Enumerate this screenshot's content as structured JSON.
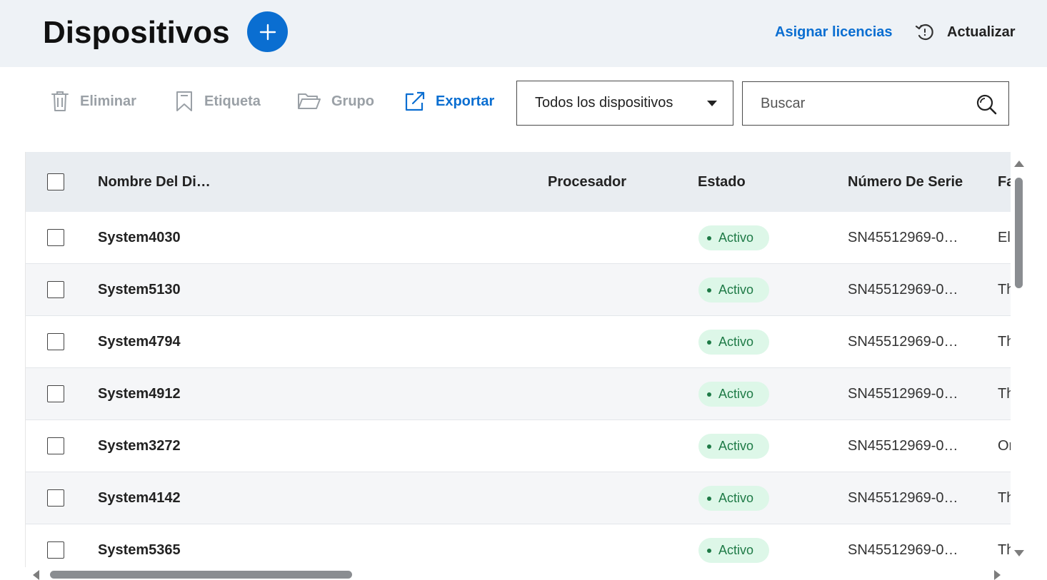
{
  "header": {
    "title": "Dispositivos",
    "assign_licenses": "Asignar licencias",
    "refresh": "Actualizar"
  },
  "toolbar": {
    "delete": "Eliminar",
    "tag": "Etiqueta",
    "group": "Grupo",
    "export": "Exportar",
    "filter_value": "Todos los dispositivos",
    "search_placeholder": "Buscar"
  },
  "table": {
    "columns": {
      "name": "Nombre Del Di…",
      "processor": "Procesador",
      "status": "Estado",
      "serial": "Número De Serie",
      "next": "Fa"
    },
    "rows": [
      {
        "name": "System4030",
        "status": "Activo",
        "serial": "SN45512969-0…",
        "next": "El"
      },
      {
        "name": "System5130",
        "status": "Activo",
        "serial": "SN45512969-0…",
        "next": "Th"
      },
      {
        "name": "System4794",
        "status": "Activo",
        "serial": "SN45512969-0…",
        "next": "Th"
      },
      {
        "name": "System4912",
        "status": "Activo",
        "serial": "SN45512969-0…",
        "next": "Th"
      },
      {
        "name": "System3272",
        "status": "Activo",
        "serial": "SN45512969-0…",
        "next": "Or"
      },
      {
        "name": "System4142",
        "status": "Activo",
        "serial": "SN45512969-0…",
        "next": "Th"
      },
      {
        "name": "System5365",
        "status": "Activo",
        "serial": "SN45512969-0…",
        "next": "Th"
      }
    ]
  },
  "icons": {
    "add": "plus-icon",
    "refresh": "refresh-icon",
    "delete": "trash-icon",
    "tag": "bookmark-icon",
    "group": "folder-icon",
    "export": "external-link-icon",
    "filter": "caret-down-icon",
    "search": "search-icon"
  },
  "colors": {
    "accent": "#0a6ed1",
    "header_bg": "#eef2f6",
    "status_bg": "#ddf7e8",
    "status_text": "#1e7a46",
    "disabled": "#9aa0a6"
  }
}
